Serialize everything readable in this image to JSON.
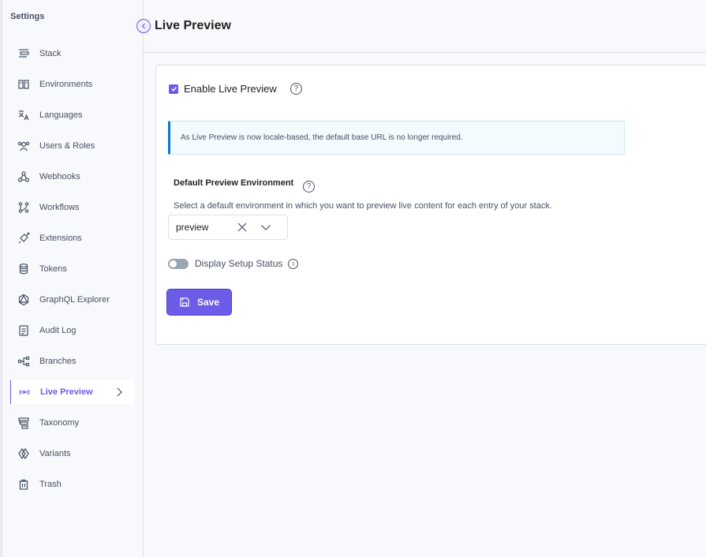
{
  "sidebar": {
    "title": "Settings",
    "items": [
      {
        "label": "Stack",
        "icon": "stack-icon"
      },
      {
        "label": "Environments",
        "icon": "environments-icon"
      },
      {
        "label": "Languages",
        "icon": "languages-icon"
      },
      {
        "label": "Users & Roles",
        "icon": "users-icon"
      },
      {
        "label": "Webhooks",
        "icon": "webhooks-icon"
      },
      {
        "label": "Workflows",
        "icon": "workflows-icon"
      },
      {
        "label": "Extensions",
        "icon": "extensions-icon"
      },
      {
        "label": "Tokens",
        "icon": "tokens-icon"
      },
      {
        "label": "GraphQL Explorer",
        "icon": "graphql-icon"
      },
      {
        "label": "Audit Log",
        "icon": "audit-log-icon"
      },
      {
        "label": "Branches",
        "icon": "branches-icon"
      },
      {
        "label": "Live Preview",
        "icon": "live-preview-icon",
        "active": true
      },
      {
        "label": "Taxonomy",
        "icon": "taxonomy-icon"
      },
      {
        "label": "Variants",
        "icon": "variants-icon"
      },
      {
        "label": "Trash",
        "icon": "trash-icon"
      }
    ]
  },
  "header": {
    "title": "Live Preview"
  },
  "form": {
    "enable_label": "Enable Live Preview",
    "enable_checked": true,
    "info_note": "As Live Preview is now locale-based, the default base URL is no longer required.",
    "section_title": "Default Preview Environment",
    "section_desc": "Select a default environment in which you want to preview live content for each entry of your stack.",
    "environment_value": "preview",
    "toggle_label": "Display Setup Status",
    "toggle_on": false,
    "save_label": "Save"
  },
  "colors": {
    "accent": "#6c5ce7",
    "info_border": "#0b78c8",
    "info_bg": "#f2fbfd",
    "sidebar_bg": "#f7f9fc"
  }
}
